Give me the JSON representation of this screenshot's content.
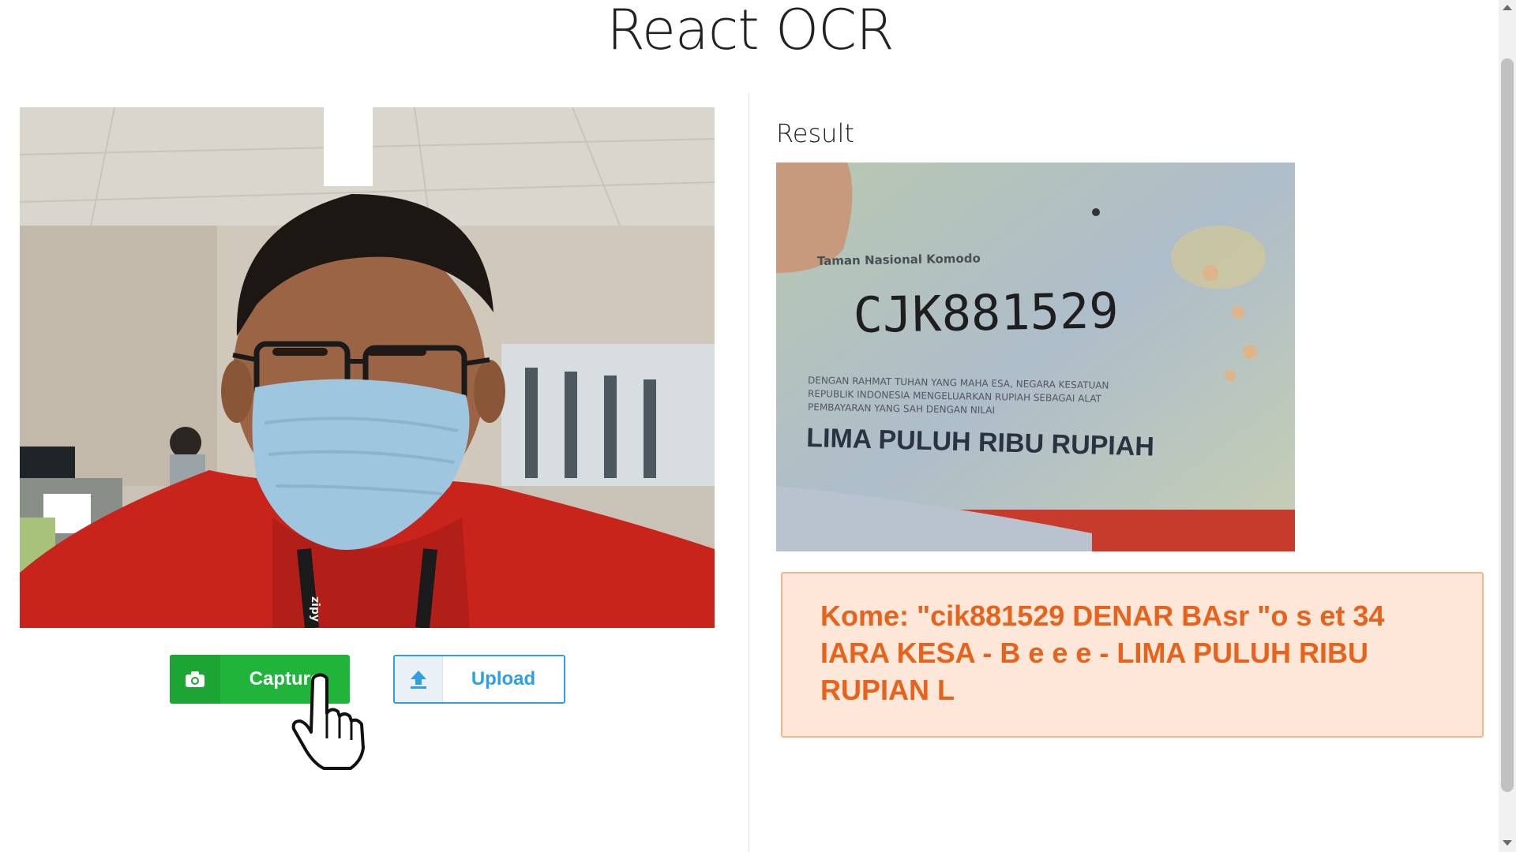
{
  "app": {
    "title": "React OCR"
  },
  "webcam": {
    "lanyard_text": "zipy"
  },
  "buttons": {
    "capture_label": "Capture",
    "upload_label": "Upload"
  },
  "result": {
    "label": "Result",
    "banknote": {
      "header_text": "Taman Nasional Komodo",
      "serial": "CJK881529",
      "small_line_1": "DENGAN RAHMAT TUHAN YANG MAHA ESA, NEGARA KESATUAN",
      "small_line_2": "REPUBLIK INDONESIA MENGELUARKAN RUPIAH SEBAGAI ALAT",
      "small_line_3": "PEMBAYARAN YANG SAH DENGAN NILAI",
      "amount_text": "LIMA PULUH RIBU RUPIAH"
    },
    "ocr_text": "Kome: \"cik881529 DENAR BAsr \"o s et 34 IARA KESA - B e e e - LIMA PULUH RIBU RUPIAN L"
  },
  "colors": {
    "capture_green": "#20b53a",
    "upload_blue": "#2e9fe3",
    "result_text_orange": "#e8621b",
    "result_bg": "#fde7d9"
  },
  "icons": {
    "capture": "camera-icon",
    "upload": "upload-icon",
    "pointer": "hand-pointer-cursor"
  }
}
